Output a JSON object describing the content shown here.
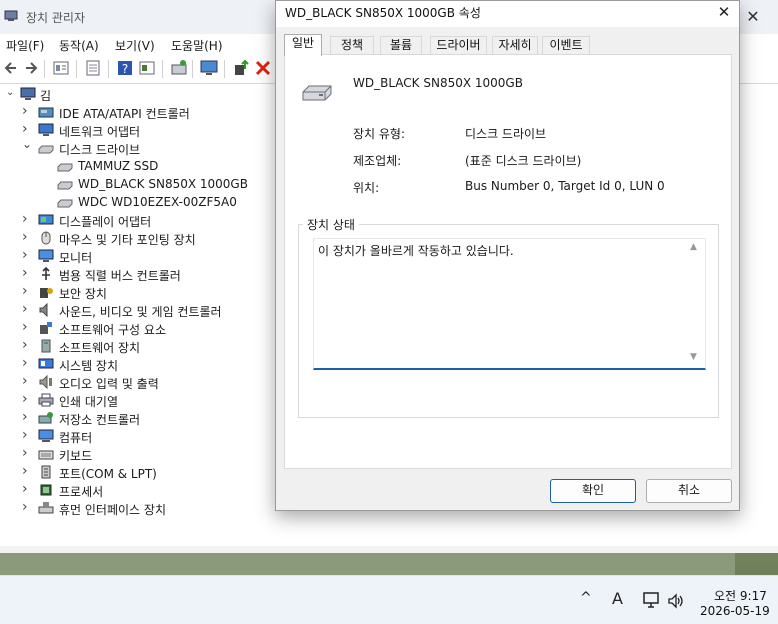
{
  "window": {
    "title": "장치 관리자",
    "close_glyph": "✕"
  },
  "menu": [
    "파일(F)",
    "동작(A)",
    "보기(V)",
    "도움말(H)"
  ],
  "toolbar_icons": [
    "back-icon",
    "forward-icon",
    "properties-icon",
    "list-icon",
    "help-icon",
    "display-icon",
    "scan-icon",
    "monitor-icon",
    "enable-icon",
    "uninstall-icon"
  ],
  "tree": {
    "root": "김",
    "categories": [
      {
        "label": "IDE ATA/ATAPI 컨트롤러",
        "icon": "ide-controller-icon",
        "expanded": false
      },
      {
        "label": "네트워크 어댑터",
        "icon": "network-adapter-icon",
        "expanded": false
      },
      {
        "label": "디스크 드라이브",
        "icon": "disk-drive-icon",
        "expanded": true,
        "children": [
          "TAMMUZ SSD",
          "WD_BLACK SN850X 1000GB",
          "WDC WD10EZEX-00ZF5A0"
        ]
      },
      {
        "label": "디스플레이 어댑터",
        "icon": "display-adapter-icon",
        "expanded": false
      },
      {
        "label": "마우스 및 기타 포인팅 장치",
        "icon": "mouse-icon",
        "expanded": false
      },
      {
        "label": "모니터",
        "icon": "monitor-icon",
        "expanded": false
      },
      {
        "label": "범용 직렬 버스 컨트롤러",
        "icon": "usb-icon",
        "expanded": false
      },
      {
        "label": "보안 장치",
        "icon": "security-device-icon",
        "expanded": false
      },
      {
        "label": "사운드, 비디오 및 게임 컨트롤러",
        "icon": "sound-icon",
        "expanded": false
      },
      {
        "label": "소프트웨어 구성 요소",
        "icon": "software-component-icon",
        "expanded": false
      },
      {
        "label": "소프트웨어 장치",
        "icon": "software-device-icon",
        "expanded": false
      },
      {
        "label": "시스템 장치",
        "icon": "system-device-icon",
        "expanded": false
      },
      {
        "label": "오디오 입력 및 출력",
        "icon": "audio-icon",
        "expanded": false
      },
      {
        "label": "인쇄 대기열",
        "icon": "printer-icon",
        "expanded": false
      },
      {
        "label": "저장소 컨트롤러",
        "icon": "storage-controller-icon",
        "expanded": false
      },
      {
        "label": "컴퓨터",
        "icon": "computer-icon",
        "expanded": false
      },
      {
        "label": "키보드",
        "icon": "keyboard-icon",
        "expanded": false
      },
      {
        "label": "포트(COM & LPT)",
        "icon": "port-icon",
        "expanded": false
      },
      {
        "label": "프로세서",
        "icon": "processor-icon",
        "expanded": false
      },
      {
        "label": "휴먼 인터페이스 장치",
        "icon": "hid-icon",
        "expanded": false
      }
    ]
  },
  "dialog": {
    "title": "WD_BLACK SN850X 1000GB 속성",
    "close_glyph": "✕",
    "tabs": [
      "일반",
      "정책",
      "볼륨",
      "드라이버",
      "자세히",
      "이벤트"
    ],
    "active_tab": "일반",
    "device_name": "WD_BLACK SN850X 1000GB",
    "properties": [
      {
        "label": "장치 유형:",
        "value": "디스크 드라이브"
      },
      {
        "label": "제조업체:",
        "value": "(표준 디스크 드라이브)"
      },
      {
        "label": "위치:",
        "value": "Bus Number 0, Target Id 0, LUN 0"
      }
    ],
    "status_group_title": "장치 상태",
    "status_text": "이 장치가 올바르게 작동하고 있습니다.",
    "ok_label": "확인",
    "cancel_label": "취소"
  },
  "taskbar": {
    "time": "오전 9:17",
    "date": "2026-05-19",
    "ime": "A"
  },
  "colors": {
    "accent": "#1b5fa8"
  }
}
